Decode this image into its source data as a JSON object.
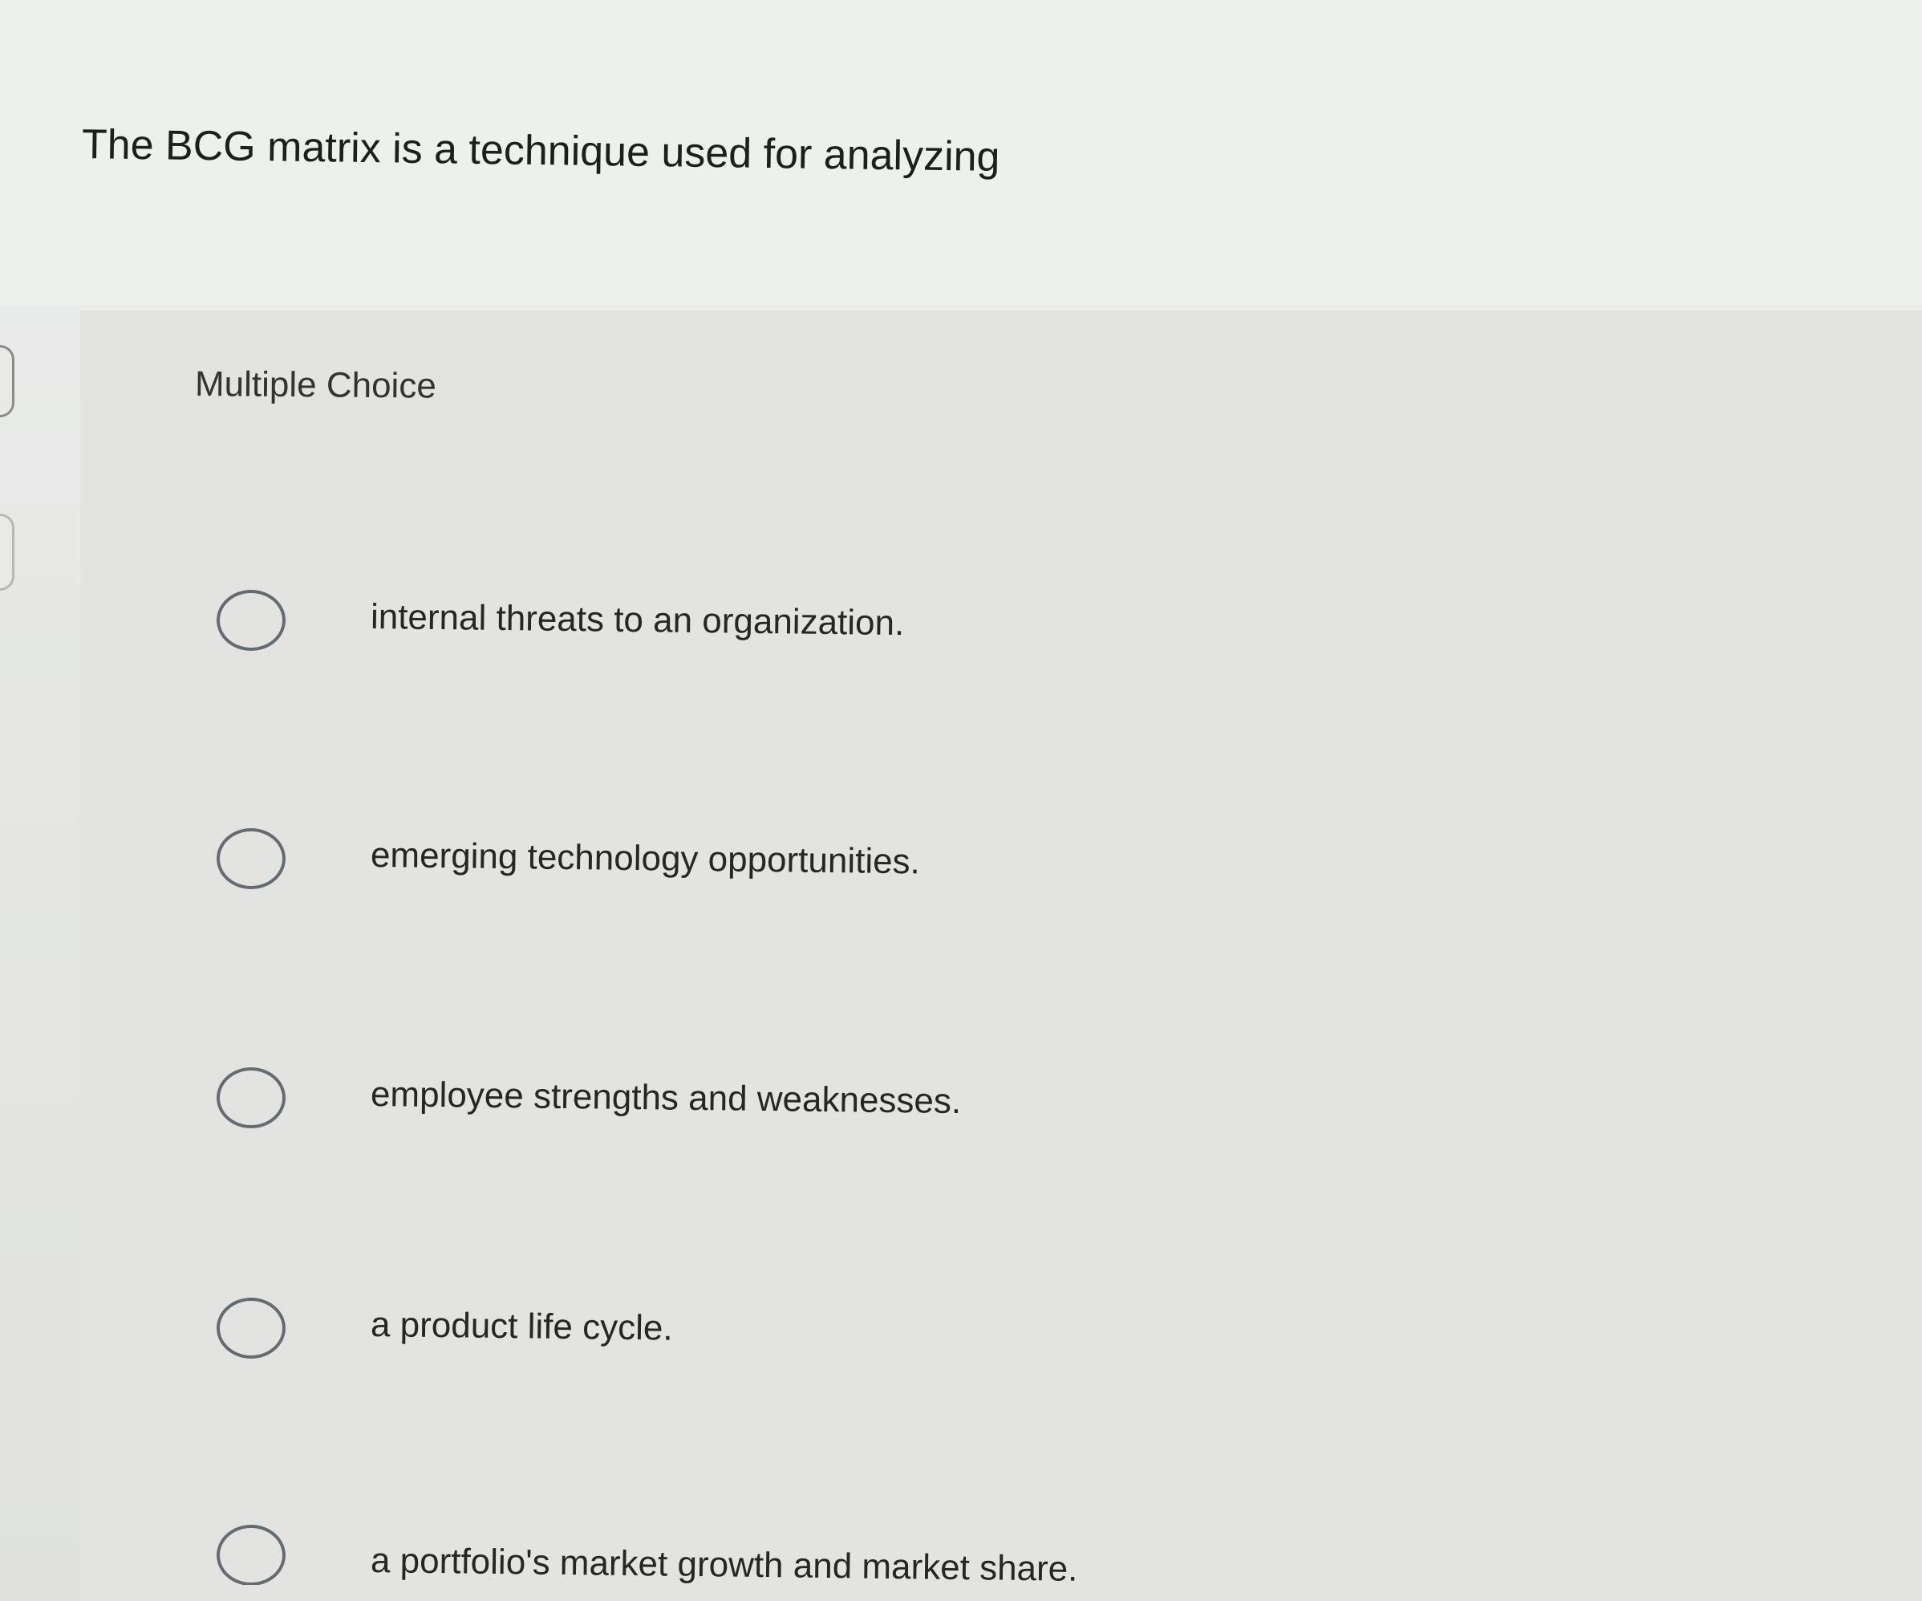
{
  "question": {
    "prompt": "The BCG matrix is a technique used for analyzing",
    "mode": "Multiple Choice"
  },
  "options": [
    {
      "label": "internal threats to an organization."
    },
    {
      "label": "emerging technology opportunities."
    },
    {
      "label": "employee strengths and weaknesses."
    },
    {
      "label": "a product life cycle."
    },
    {
      "label": "a portfolio's market growth and market share."
    }
  ]
}
